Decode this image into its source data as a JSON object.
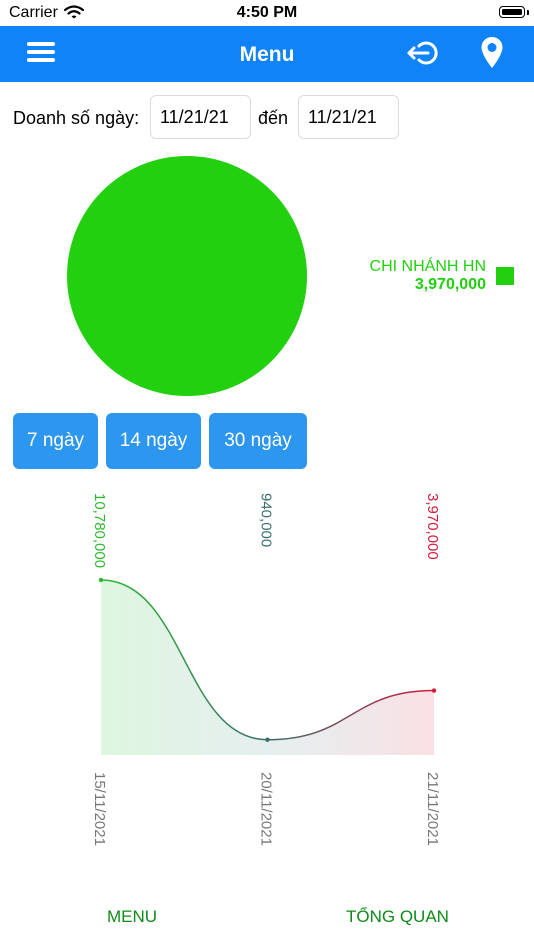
{
  "status_bar": {
    "carrier": "Carrier",
    "time": "4:50 PM"
  },
  "nav": {
    "title": "Menu"
  },
  "filter": {
    "label": "Doanh số ngày:",
    "from_date": "11/21/21",
    "to_label": "đến",
    "to_date": "11/21/21"
  },
  "pie_chart": {
    "legend": [
      {
        "name": "CHI NHÁNH HN",
        "value": "3,970,000",
        "color": "#22d010"
      }
    ]
  },
  "period_buttons": [
    {
      "label": "7 ngày"
    },
    {
      "label": "14 ngày"
    },
    {
      "label": "30 ngày"
    }
  ],
  "chart_data": [
    {
      "type": "pie",
      "labels": [
        "CHI NHÁNH HN"
      ],
      "values": [
        3970000
      ],
      "colors": [
        "#22d010"
      ],
      "legend_position": "right"
    },
    {
      "type": "line",
      "x": [
        "15/11/2021",
        "20/11/2021",
        "21/11/2021"
      ],
      "series": [
        {
          "values": [
            10780000,
            940000,
            3970000
          ]
        }
      ],
      "value_labels": [
        "10,780,000",
        "940,000",
        "3,970,000"
      ],
      "label_colors": [
        "#2eb82e",
        "#3c6e6e",
        "#d01b3c"
      ],
      "fill": "gradient"
    }
  ],
  "bottom_tabs": {
    "menu": "MENU",
    "overview": "TỔNG QUAN"
  }
}
